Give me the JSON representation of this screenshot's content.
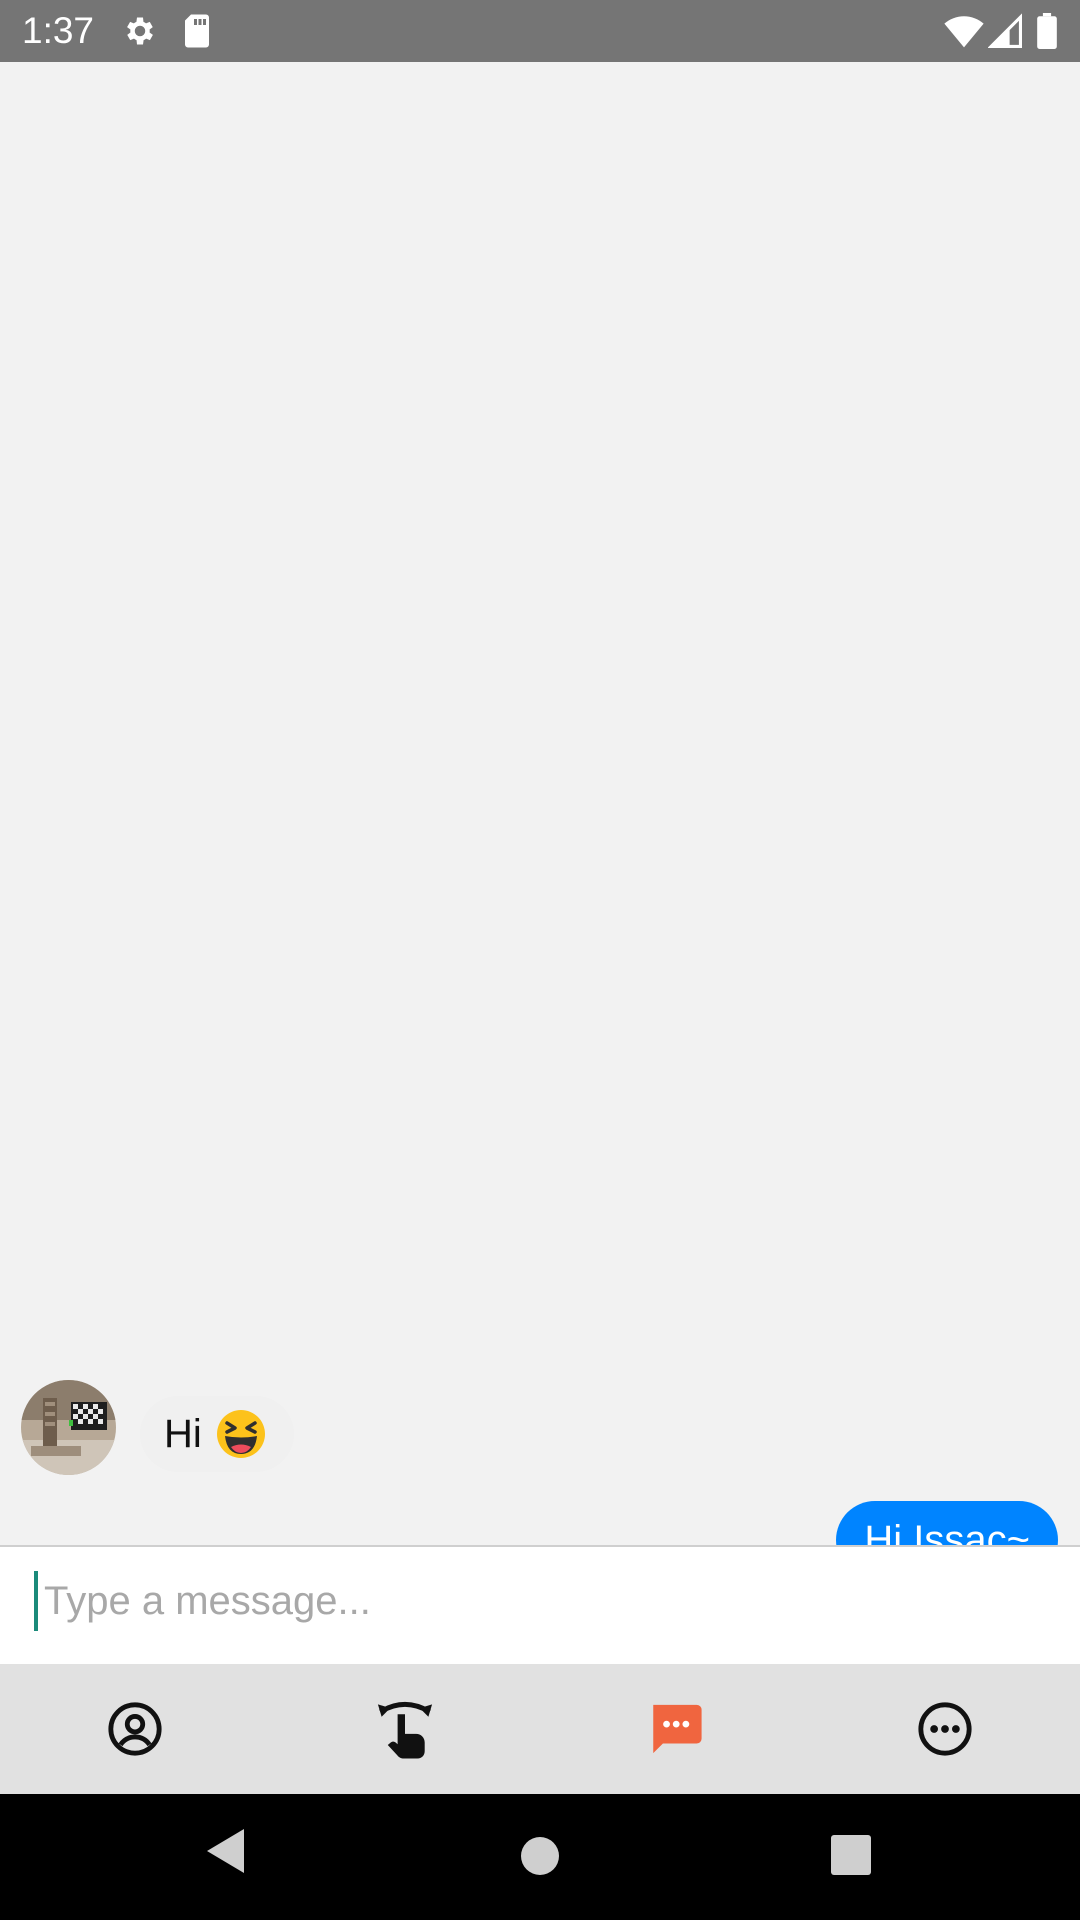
{
  "status_bar": {
    "time": "1:37",
    "icons": [
      "settings-gear-icon",
      "sd-card-icon",
      "wifi-icon",
      "signal-icon",
      "battery-icon"
    ]
  },
  "chat": {
    "messages": [
      {
        "direction": "incoming",
        "text": "Hi",
        "emoji": "laughing-face-emoji"
      },
      {
        "direction": "outgoing",
        "text": "Hi Issac~"
      }
    ]
  },
  "composer": {
    "placeholder": "Type a message...",
    "value": ""
  },
  "tabs": [
    {
      "icon": "account-circle-icon",
      "active": false
    },
    {
      "icon": "swipe-gesture-icon",
      "active": false
    },
    {
      "icon": "chat-bubble-icon",
      "active": true
    },
    {
      "icon": "more-horizontal-icon",
      "active": false
    }
  ],
  "colors": {
    "status_bar": "#757575",
    "outgoing_bubble": "#0084ff",
    "active_tab": "#f0653f",
    "tab_bar": "#e1e1e1"
  }
}
